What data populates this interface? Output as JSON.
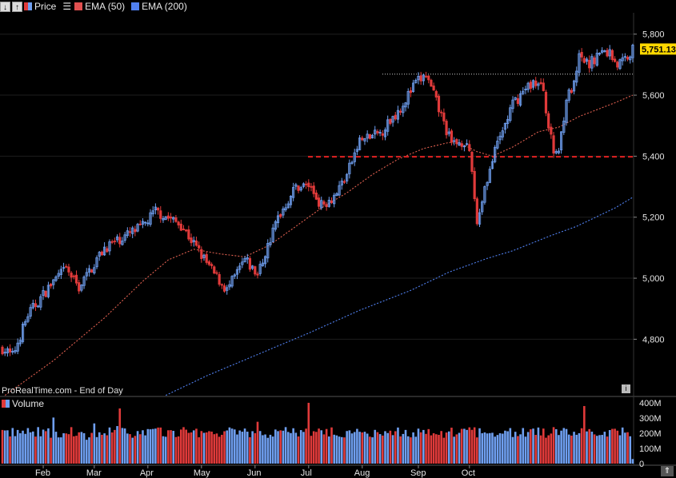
{
  "legend": {
    "price_label": "Price",
    "ema50_label": "EMA (50)",
    "ema200_label": "EMA (200)"
  },
  "volume_label": "Volume",
  "source": "ProRealTime.com - End of Day",
  "last_price_label": "5,751.13",
  "colors": {
    "up": "#6f9ff0",
    "down": "#e03a3a",
    "ema50": "#e06050",
    "ema200": "#5080f0",
    "support": "#e02020",
    "price_tag": "#ffd800",
    "background": "#000000",
    "grid": "#1e1e1e"
  },
  "chart_data": {
    "type": "candlestick",
    "x_ticks": [
      "Feb",
      "Mar",
      "Apr",
      "May",
      "Jun",
      "Jul",
      "Aug",
      "Sep",
      "Oct"
    ],
    "y_ticks": [
      "4,800",
      "5,000",
      "5,200",
      "5,400",
      "5,600",
      "5,800"
    ],
    "y_tick_values": [
      4800,
      5000,
      5200,
      5400,
      5600,
      5800
    ],
    "ylim": [
      4615,
      5870
    ],
    "volume_ticks": [
      "400M",
      "300M",
      "200M",
      "100M",
      "0"
    ],
    "volume_tick_values": [
      400,
      300,
      200,
      100,
      0
    ],
    "volume_ylim": [
      0,
      420
    ],
    "last_price": 5751.13,
    "support_level": 5398,
    "resistance_level": 5669,
    "close_anchors": [
      [
        0,
        4770
      ],
      [
        4,
        4745
      ],
      [
        10,
        4880
      ],
      [
        20,
        4990
      ],
      [
        25,
        5030
      ],
      [
        30,
        4970
      ],
      [
        40,
        5100
      ],
      [
        55,
        5170
      ],
      [
        60,
        5220
      ],
      [
        70,
        5175
      ],
      [
        82,
        5025
      ],
      [
        88,
        4960
      ],
      [
        95,
        5060
      ],
      [
        100,
        5010
      ],
      [
        108,
        5200
      ],
      [
        115,
        5300
      ],
      [
        120,
        5305
      ],
      [
        125,
        5240
      ],
      [
        130,
        5270
      ],
      [
        135,
        5340
      ],
      [
        140,
        5450
      ],
      [
        148,
        5475
      ],
      [
        156,
        5560
      ],
      [
        162,
        5640
      ],
      [
        166,
        5665
      ],
      [
        171,
        5555
      ],
      [
        176,
        5440
      ],
      [
        181,
        5450
      ],
      [
        183,
        5400
      ],
      [
        184,
        5350
      ],
      [
        186,
        5180
      ],
      [
        189,
        5300
      ],
      [
        194,
        5440
      ],
      [
        200,
        5570
      ],
      [
        205,
        5620
      ],
      [
        208,
        5645
      ],
      [
        212,
        5620
      ],
      [
        214,
        5495
      ],
      [
        216,
        5415
      ],
      [
        218,
        5420
      ],
      [
        221,
        5590
      ],
      [
        224,
        5630
      ],
      [
        226,
        5720
      ],
      [
        230,
        5700
      ],
      [
        234,
        5740
      ],
      [
        238,
        5740
      ],
      [
        241,
        5700
      ],
      [
        244,
        5720
      ],
      [
        247,
        5751
      ]
    ],
    "ema50_anchors": [
      [
        0,
        4610
      ],
      [
        20,
        4730
      ],
      [
        40,
        4870
      ],
      [
        55,
        4990
      ],
      [
        65,
        5060
      ],
      [
        75,
        5095
      ],
      [
        85,
        5080
      ],
      [
        95,
        5070
      ],
      [
        105,
        5110
      ],
      [
        115,
        5170
      ],
      [
        125,
        5230
      ],
      [
        135,
        5280
      ],
      [
        145,
        5340
      ],
      [
        155,
        5390
      ],
      [
        165,
        5425
      ],
      [
        175,
        5445
      ],
      [
        180,
        5440
      ],
      [
        186,
        5415
      ],
      [
        192,
        5400
      ],
      [
        200,
        5430
      ],
      [
        210,
        5480
      ],
      [
        218,
        5495
      ],
      [
        226,
        5530
      ],
      [
        240,
        5575
      ],
      [
        247,
        5600
      ]
    ],
    "ema200_anchors": [
      [
        60,
        4600
      ],
      [
        80,
        4680
      ],
      [
        100,
        4750
      ],
      [
        120,
        4820
      ],
      [
        140,
        4895
      ],
      [
        160,
        4960
      ],
      [
        175,
        5020
      ],
      [
        190,
        5065
      ],
      [
        200,
        5090
      ],
      [
        215,
        5140
      ],
      [
        225,
        5170
      ],
      [
        240,
        5230
      ],
      [
        247,
        5265
      ]
    ],
    "volume_range_millions": [
      150,
      420
    ]
  }
}
